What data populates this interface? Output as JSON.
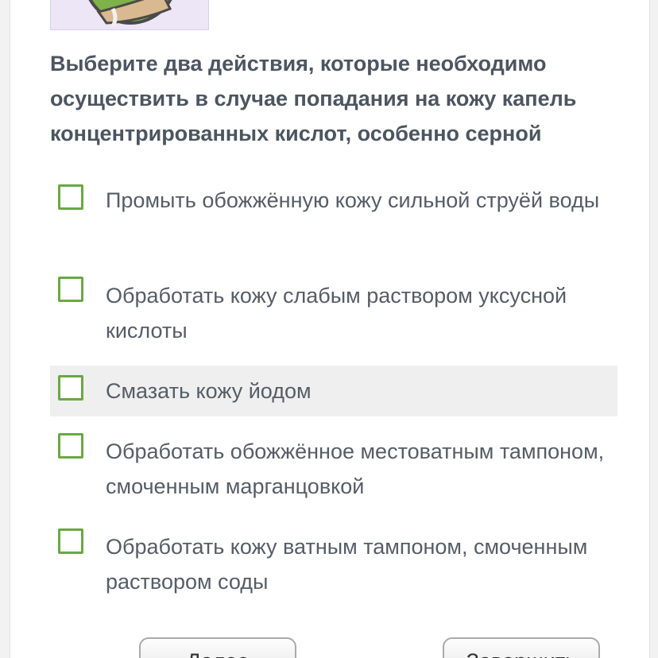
{
  "question": {
    "text": "Выберите два действия, которые необходимо осуществить в случае попадания на кожу капель концентрированных кислот, особенно серной"
  },
  "options": [
    {
      "label": "Промыть обожжённую кожу сильной струёй воды",
      "checked": false,
      "highlighted": false
    },
    {
      "label": "Обработать кожу слабым раствором уксусной кислоты",
      "checked": false,
      "highlighted": false
    },
    {
      "label": "Смазать кожу йодом",
      "checked": false,
      "highlighted": true
    },
    {
      "label": "Обработать обожжённое местоватным тампоном, смоченным марганцовкой",
      "checked": false,
      "highlighted": false
    },
    {
      "label": "Обработать кожу ватным тампоном, смоченным раствором соды",
      "checked": false,
      "highlighted": false
    }
  ],
  "buttons": {
    "next_label": "Далее",
    "finish_label": "Завершить"
  },
  "colors": {
    "checkbox_border": "#6aa842",
    "question_text": "#4c5560",
    "option_text": "#565d66",
    "highlight_bg": "#efefef",
    "illustration_bg": "#ece6f7"
  },
  "icons": {
    "illustration": "acid-drop-on-hand-illustration",
    "checkbox": "checkbox-empty-icon"
  }
}
